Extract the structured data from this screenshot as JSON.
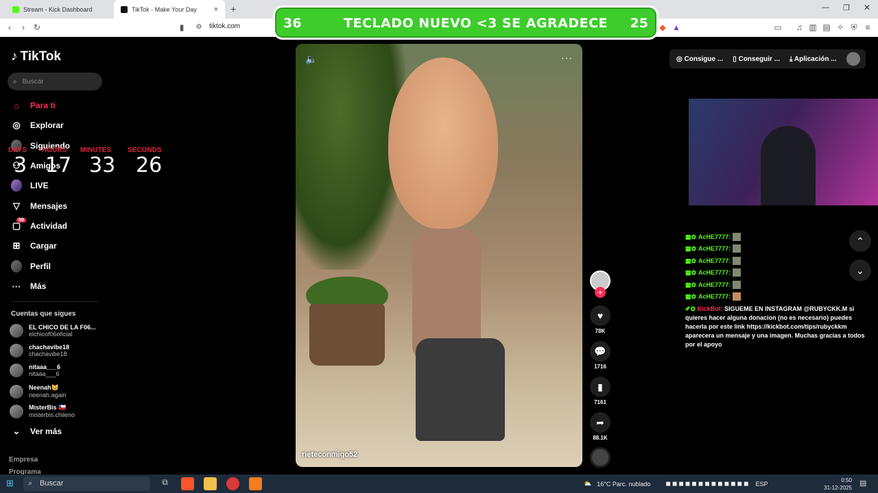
{
  "browser": {
    "tabs": [
      {
        "label": "Stream - Kick Dashboard",
        "active": false
      },
      {
        "label": "TikTok - Make Your Day",
        "active": true
      }
    ],
    "url": "tiktok.com"
  },
  "banner": {
    "left_number": "36",
    "text": "TECLADO NUEVO <3 SE AGRADECE",
    "right_number": "25"
  },
  "sidebar": {
    "logo": "TikTok",
    "search_placeholder": "Buscar",
    "nav": [
      {
        "label": "Para ti",
        "icon": "home-icon"
      },
      {
        "label": "Explorar",
        "icon": "compass-icon"
      },
      {
        "label": "Siguiendo",
        "icon": "following-icon"
      },
      {
        "label": "Amigos",
        "icon": "friends-icon"
      },
      {
        "label": "LIVE",
        "icon": "live-icon"
      },
      {
        "label": "Mensajes",
        "icon": "messages-icon"
      },
      {
        "label": "Actividad",
        "icon": "activity-icon",
        "badge": "59"
      },
      {
        "label": "Cargar",
        "icon": "upload-icon"
      },
      {
        "label": "Perfil",
        "icon": "profile-icon"
      },
      {
        "label": "Más",
        "icon": "more-icon"
      }
    ],
    "following_heading": "Cuentas que sigues",
    "following": [
      {
        "name": "EL CHICO DE LA F06...",
        "handle": "elchicof06oficial"
      },
      {
        "name": "chachavibe18",
        "handle": "chachavibe18"
      },
      {
        "name": "nitaaa___6",
        "handle": "nitaaa___6"
      },
      {
        "name": "Neenah😸",
        "handle": "neenah.again"
      },
      {
        "name": "MisterBis 🇨🇱",
        "handle": "misterbis.chileno"
      }
    ],
    "see_more": "Ver más",
    "footer": [
      "Empresa",
      "Programa"
    ]
  },
  "countdown": {
    "labels": [
      "DAYS",
      "HOURS",
      "MINUTES",
      "SECONDS"
    ],
    "values": [
      "3",
      "17",
      "33",
      "26"
    ]
  },
  "video": {
    "author": "rieteconmigo52"
  },
  "actions": {
    "likes": "78K",
    "comments": "1716",
    "saves": "7161",
    "shares": "88.1K"
  },
  "topbar": {
    "coins": "Consigue ...",
    "get": "Conseguir ...",
    "app": "Aplicación ..."
  },
  "chat": {
    "messages": [
      {
        "user": "AcHE7777:"
      },
      {
        "user": "AcHE7777:"
      },
      {
        "user": "AcHE7777:"
      },
      {
        "user": "AcHE7777:"
      },
      {
        "user": "AcHE7777:"
      },
      {
        "user": "AcHE7777:"
      }
    ],
    "kickbot_user": "KickBot:",
    "kickbot_text": "SIGUEME EN INSTAGRAM @RUBYCKK.M si quieres hacer alguna donacion (no es necesario) puedes hacerla por este link https://kickbot.com/tips/rubyckkm aparecera un mensaje y una imagen. Muchas gracias a todos por el apoyo"
  },
  "taskbar": {
    "search": "Buscar",
    "weather": "16°C  Parc. nublado",
    "lang": "ESP",
    "time": "0:50",
    "date": "31-12-2025"
  },
  "colors": {
    "accent": "#fe2c55",
    "kick_green": "#53fc18",
    "banner_green": "#3dcc2c"
  }
}
